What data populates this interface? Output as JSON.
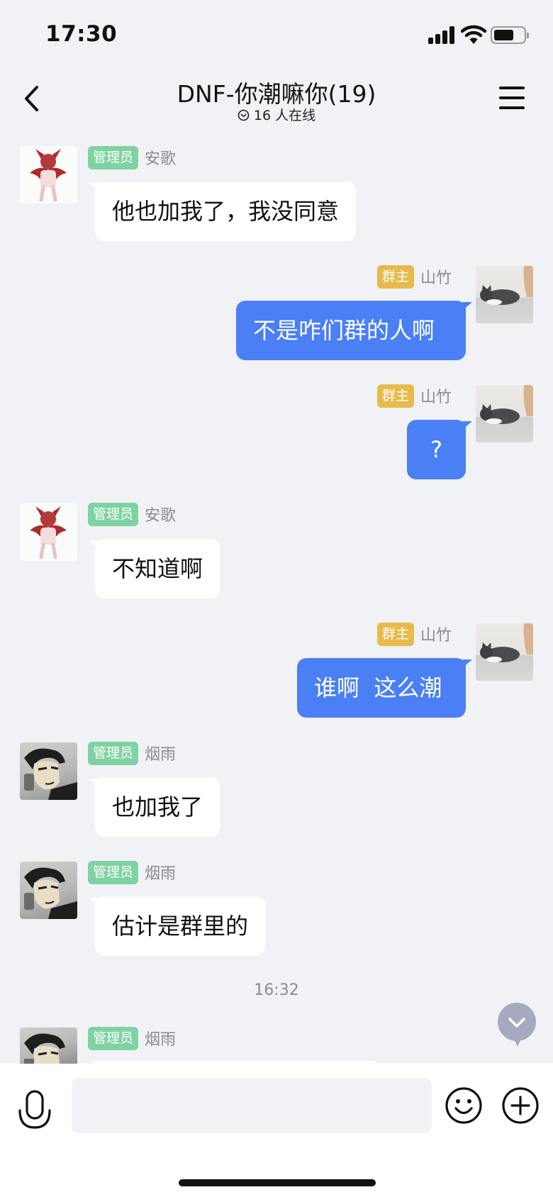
{
  "status_bar": {
    "time": "17:30"
  },
  "header": {
    "title": "DNF-你潮嘛你(19)",
    "online": "16 人在线"
  },
  "messages": [
    {
      "badge": "管理员",
      "sender": "安歌",
      "text": "他也加我了，我没同意",
      "direction": "incoming",
      "avatar": "devil-avatar"
    },
    {
      "badge": "群主",
      "sender": "山竹",
      "text": "不是咋们群的人啊",
      "direction": "outgoing",
      "avatar": "cat-avatar"
    },
    {
      "badge": "群主",
      "sender": "山竹",
      "text": "?",
      "direction": "outgoing",
      "avatar": "cat-avatar"
    },
    {
      "badge": "管理员",
      "sender": "安歌",
      "text": "不知道啊",
      "direction": "incoming",
      "avatar": "devil-avatar"
    },
    {
      "badge": "群主",
      "sender": "山竹",
      "text": "谁啊  这么潮",
      "direction": "outgoing",
      "avatar": "cat-avatar"
    },
    {
      "badge": "管理员",
      "sender": "烟雨",
      "text": "也加我了",
      "direction": "incoming",
      "avatar": "anime-avatar"
    },
    {
      "badge": "管理员",
      "sender": "烟雨",
      "text": "估计是群里的",
      "direction": "incoming",
      "avatar": "anime-avatar"
    }
  ],
  "timestamp": "16:32",
  "partial_message": {
    "badge": "管理员",
    "sender": "烟雨"
  },
  "input": {
    "value": "",
    "placeholder": ""
  },
  "colors": {
    "background": "#f1f2f6",
    "outgoing_bubble": "#4a7ff5",
    "incoming_bubble": "#ffffff",
    "admin_badge": "#7fd2a1",
    "owner_badge": "#e8ba4c"
  }
}
